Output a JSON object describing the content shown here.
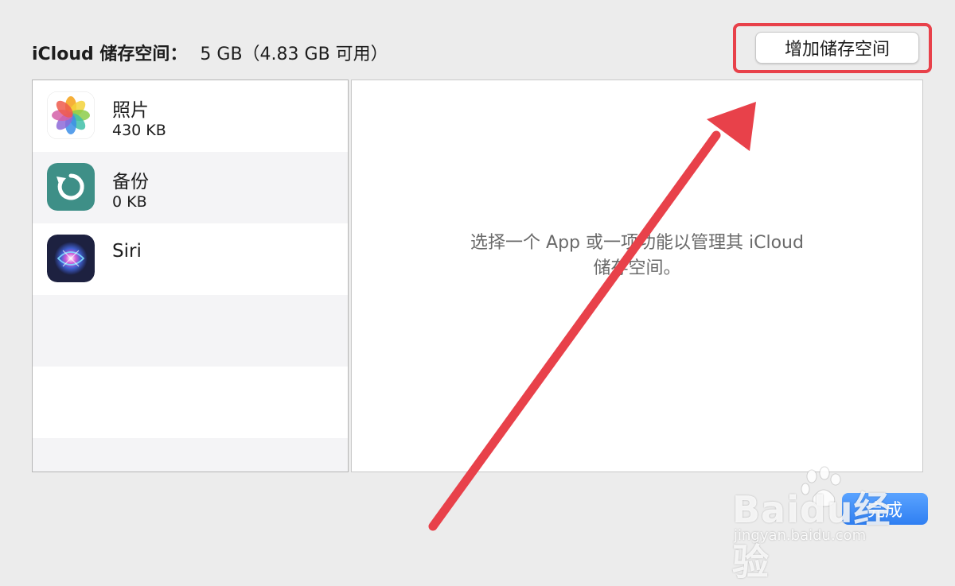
{
  "header": {
    "storage_label": "iCloud 储存空间：",
    "storage_value": "5  GB（4.83  GB 可用）"
  },
  "buttons": {
    "add_storage": "增加储存空间",
    "done": "完成"
  },
  "apps": [
    {
      "name": "照片",
      "size": "430  KB",
      "icon": "photos-icon"
    },
    {
      "name": "备份",
      "size": "0  KB",
      "icon": "backup-icon"
    },
    {
      "name": "Siri",
      "size": "",
      "icon": "siri-icon"
    }
  ],
  "detail": {
    "message": "选择一个 App 或一项功能以管理其 iCloud 储存空间。"
  },
  "watermark": {
    "main": "Baidu经验",
    "sub": "jingyan.baidu.com"
  },
  "colors": {
    "highlight": "#e8414a",
    "button_blue": "#2f7ff2",
    "backup_icon": "#3e8f87"
  }
}
